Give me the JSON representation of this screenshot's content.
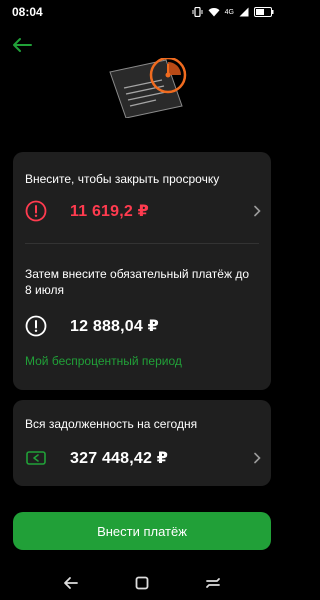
{
  "status_bar": {
    "time": "08:04",
    "network": "4G",
    "battery": "55"
  },
  "overdue_card": {
    "title": "Внесите, чтобы закрыть просрочку",
    "overdue_amount": "11 619,2 ₽",
    "mandatory_title": "Затем внесите обязательный платёж до 8 июля",
    "mandatory_amount": "12 888,04 ₽",
    "period_link": "Мой беспроцентный период"
  },
  "debt_card": {
    "title": "Вся задолженность на сегодня",
    "amount": "327 448,42 ₽"
  },
  "pay_button": "Внести платёж",
  "colors": {
    "background": "#000000",
    "card": "#1f1f1f",
    "accent_green": "#21a038",
    "alert_red": "#ff3b4f",
    "hero_orange": "#f06b1f"
  },
  "icons": {
    "back": "arrow-left-icon",
    "hero": "calendar-clock-illustration",
    "alert": "exclamation-circle-icon",
    "card": "credit-card-icon",
    "chevron": "chevron-right-icon"
  }
}
